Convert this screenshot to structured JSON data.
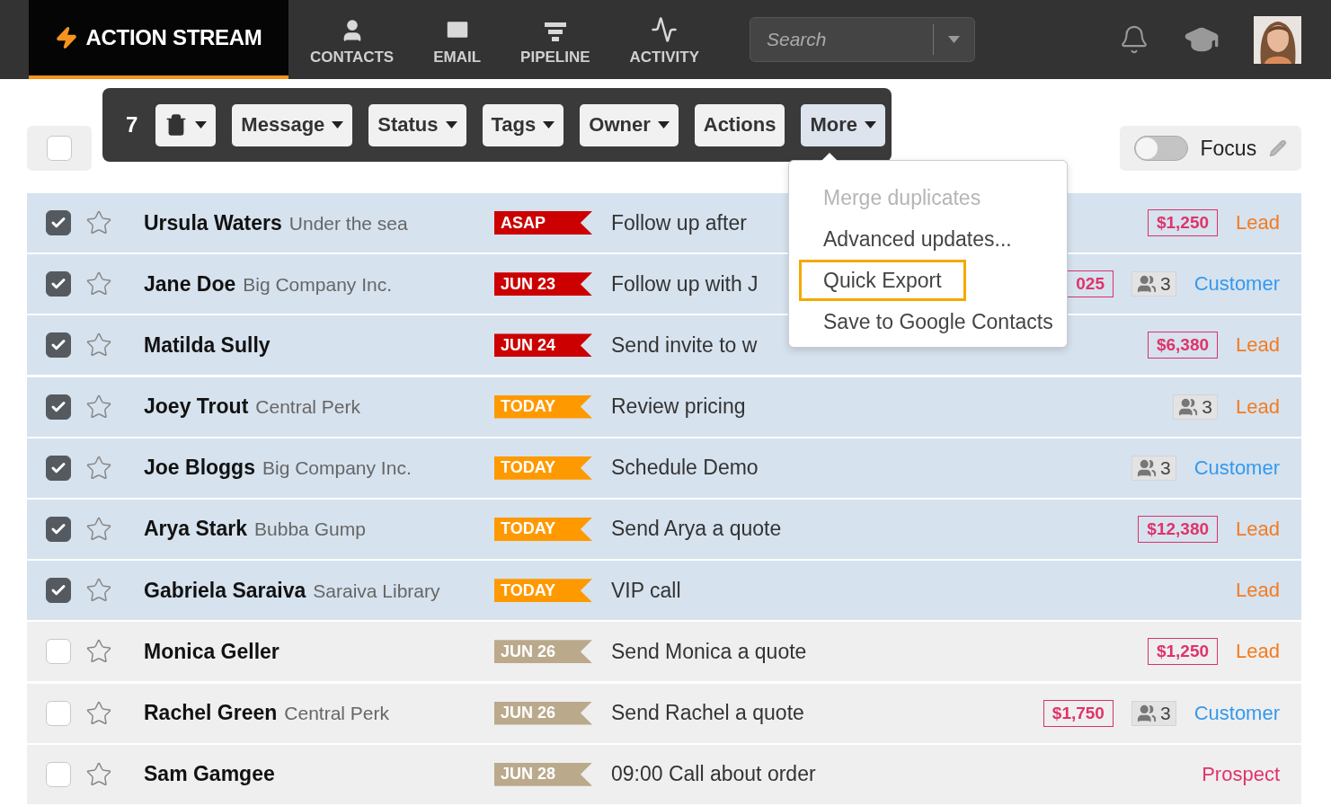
{
  "nav": {
    "brand": "ACTION STREAM",
    "items": [
      {
        "label": "CONTACTS",
        "kind": "contacts"
      },
      {
        "label": "EMAIL",
        "kind": "email"
      },
      {
        "label": "PIPELINE",
        "kind": "pipeline"
      },
      {
        "label": "ACTIVITY",
        "kind": "activity"
      }
    ],
    "search": {
      "placeholder": "Search"
    }
  },
  "select_all": {
    "checked": false
  },
  "bulk_toolbar": {
    "count": "7",
    "buttons": [
      {
        "kind": "delete",
        "caret": true,
        "selected": false
      },
      {
        "kind": "text",
        "label": "Message",
        "caret": true,
        "selected": false
      },
      {
        "kind": "text",
        "label": "Status",
        "caret": true,
        "selected": false
      },
      {
        "kind": "text",
        "label": "Tags",
        "caret": true,
        "selected": false
      },
      {
        "kind": "text",
        "label": "Owner",
        "caret": true,
        "selected": false
      },
      {
        "kind": "text",
        "label": "Actions",
        "caret": false,
        "selected": false
      },
      {
        "kind": "text",
        "label": "More",
        "caret": true,
        "selected": true
      }
    ]
  },
  "focus": {
    "label": "Focus",
    "on": false
  },
  "more_menu": [
    {
      "label": "Merge duplicates",
      "disabled": true,
      "highlighted": false
    },
    {
      "label": "Advanced updates...",
      "disabled": false,
      "highlighted": false
    },
    {
      "label": "Quick Export",
      "disabled": false,
      "highlighted": true
    },
    {
      "label": "Save to Google Contacts",
      "disabled": false,
      "highlighted": false
    }
  ],
  "rows": [
    {
      "checked": true,
      "starred": false,
      "name": "Ursula Waters",
      "company": "Under the sea",
      "tag": {
        "label": "ASAP",
        "color": "#cc0000"
      },
      "task": "Follow up after",
      "amount": "$1,250",
      "status": {
        "label": "Lead",
        "color": "#f47b20"
      }
    },
    {
      "checked": true,
      "starred": false,
      "name": "Jane Doe",
      "company": "Big Company Inc.",
      "tag": {
        "label": "JUN 23",
        "color": "#cc0000"
      },
      "task": "Follow up with J",
      "amount": "025",
      "contacts": "3",
      "status": {
        "label": "Customer",
        "color": "#3399ee"
      }
    },
    {
      "checked": true,
      "starred": false,
      "name": "Matilda Sully",
      "tag": {
        "label": "JUN 24",
        "color": "#cc0000"
      },
      "task": "Send invite to w",
      "amount": "$6,380",
      "status": {
        "label": "Lead",
        "color": "#f47b20"
      }
    },
    {
      "checked": true,
      "starred": false,
      "name": "Joey Trout",
      "company": "Central Perk",
      "tag": {
        "label": "TODAY",
        "color": "#ff9900"
      },
      "task": "Review pricing",
      "contacts": "3",
      "status": {
        "label": "Lead",
        "color": "#f47b20"
      }
    },
    {
      "checked": true,
      "starred": false,
      "name": "Joe Bloggs",
      "company": "Big Company Inc.",
      "tag": {
        "label": "TODAY",
        "color": "#ff9900"
      },
      "task": "Schedule Demo",
      "contacts": "3",
      "status": {
        "label": "Customer",
        "color": "#3399ee"
      }
    },
    {
      "checked": true,
      "starred": false,
      "name": "Arya Stark",
      "company": "Bubba Gump",
      "tag": {
        "label": "TODAY",
        "color": "#ff9900"
      },
      "task": "Send Arya a quote",
      "amount": "$12,380",
      "status": {
        "label": "Lead",
        "color": "#f47b20"
      }
    },
    {
      "checked": true,
      "starred": false,
      "name": "Gabriela Saraiva",
      "company": "Saraiva Library",
      "tag": {
        "label": "TODAY",
        "color": "#ff9900"
      },
      "task": "VIP call",
      "status": {
        "label": "Lead",
        "color": "#f47b20"
      }
    },
    {
      "checked": false,
      "starred": false,
      "name": "Monica Geller",
      "tag": {
        "label": "JUN 26",
        "color": "#bba98c"
      },
      "task": "Send Monica a quote",
      "amount": "$1,250",
      "status": {
        "label": "Lead",
        "color": "#f47b20"
      }
    },
    {
      "checked": false,
      "starred": false,
      "name": "Rachel Green",
      "company": "Central Perk",
      "tag": {
        "label": "JUN 26",
        "color": "#bba98c"
      },
      "task": "Send Rachel a quote",
      "amount": "$1,750",
      "contacts": "3",
      "status": {
        "label": "Customer",
        "color": "#3399ee"
      }
    },
    {
      "checked": false,
      "starred": false,
      "name": "Sam Gamgee",
      "tag": {
        "label": "JUN 28",
        "color": "#bba98c"
      },
      "task": "09:00 Call about order",
      "status": {
        "label": "Prospect",
        "color": "#e0336a"
      }
    }
  ]
}
